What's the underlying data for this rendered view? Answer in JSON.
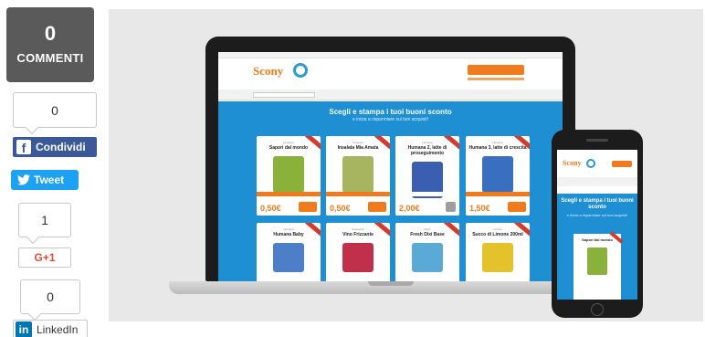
{
  "share": {
    "comments": {
      "count": "0",
      "label": "COMMENTI"
    },
    "facebook": {
      "count": "0",
      "label": "Condividi",
      "icon": "facebook-icon"
    },
    "twitter": {
      "label": "Tweet",
      "icon": "twitter-bird-icon"
    },
    "googleplus": {
      "count": "1",
      "label": "G+1"
    },
    "linkedin": {
      "count": "0",
      "label": "LinkedIn",
      "icon_text": "in"
    }
  },
  "hero": {
    "brand": "Scony",
    "headline": "Scegli e stampa i tuoi buoni sconto",
    "subheadline": "e inizia a risparmiare sui tuoi acquisti!",
    "phone_headline": "Scegli e stampa i tuoi buoni sconto",
    "products": [
      {
        "brand": "Ceneaco",
        "name": "Sapori dal mondo",
        "price": "0,50€",
        "color": "#8ab23a"
      },
      {
        "brand": "Ceneaco",
        "name": "Insalata Mia Amata",
        "price": "0,50€",
        "color": "#a7b561"
      },
      {
        "brand": "Humana",
        "name": "Humana 2, latte di proseguimento",
        "price": "2,00€",
        "color": "#3a5fb0"
      },
      {
        "brand": "Humana",
        "name": "Humana 3, latte di crescita",
        "price": "1,50€",
        "color": "#3a6fc0"
      },
      {
        "brand": "Humana",
        "name": "Humana Baby",
        "price": "",
        "color": "#4d7fc9"
      },
      {
        "brand": "Spumante",
        "name": "Vino Frizzante",
        "price": "",
        "color": "#c0304a"
      },
      {
        "brand": "Dash",
        "name": "Fresh Dixi Base",
        "price": "",
        "color": "#5aa9d6"
      },
      {
        "brand": "Limone",
        "name": "Succo di Limone 200ml",
        "price": "",
        "color": "#e3c22b"
      }
    ],
    "phone_product": {
      "name": "Sapori dal mondo"
    }
  }
}
